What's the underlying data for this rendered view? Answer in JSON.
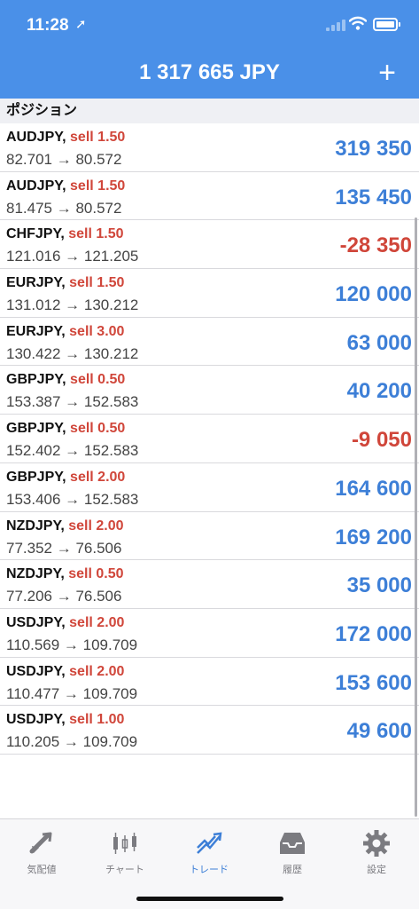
{
  "status_bar": {
    "time": "11:28",
    "location_arrow": "➚"
  },
  "nav": {
    "title": "1 317 665 JPY",
    "add_label": "+"
  },
  "section_header": "ポジション",
  "positions": [
    {
      "pair": "AUDJPY,",
      "side": "sell 1.50",
      "prices": "82.701 → 80.572",
      "pnl": "319 350",
      "sign": "pos"
    },
    {
      "pair": "AUDJPY,",
      "side": "sell 1.50",
      "prices": "81.475 → 80.572",
      "pnl": "135 450",
      "sign": "pos"
    },
    {
      "pair": "CHFJPY,",
      "side": "sell 1.50",
      "prices": "121.016 → 121.205",
      "pnl": "-28 350",
      "sign": "neg"
    },
    {
      "pair": "EURJPY,",
      "side": "sell 1.50",
      "prices": "131.012 → 130.212",
      "pnl": "120 000",
      "sign": "pos"
    },
    {
      "pair": "EURJPY,",
      "side": "sell 3.00",
      "prices": "130.422 → 130.212",
      "pnl": "63 000",
      "sign": "pos"
    },
    {
      "pair": "GBPJPY,",
      "side": "sell 0.50",
      "prices": "153.387 → 152.583",
      "pnl": "40 200",
      "sign": "pos"
    },
    {
      "pair": "GBPJPY,",
      "side": "sell 0.50",
      "prices": "152.402 → 152.583",
      "pnl": "-9 050",
      "sign": "neg"
    },
    {
      "pair": "GBPJPY,",
      "side": "sell 2.00",
      "prices": "153.406 → 152.583",
      "pnl": "164 600",
      "sign": "pos"
    },
    {
      "pair": "NZDJPY,",
      "side": "sell 2.00",
      "prices": "77.352 → 76.506",
      "pnl": "169 200",
      "sign": "pos"
    },
    {
      "pair": "NZDJPY,",
      "side": "sell 0.50",
      "prices": "77.206 → 76.506",
      "pnl": "35 000",
      "sign": "pos"
    },
    {
      "pair": "USDJPY,",
      "side": "sell 2.00",
      "prices": "110.569 → 109.709",
      "pnl": "172 000",
      "sign": "pos"
    },
    {
      "pair": "USDJPY,",
      "side": "sell 2.00",
      "prices": "110.477 → 109.709",
      "pnl": "153 600",
      "sign": "pos"
    },
    {
      "pair": "USDJPY,",
      "side": "sell 1.00",
      "prices": "110.205 → 109.709",
      "pnl": "49 600",
      "sign": "pos"
    }
  ],
  "tabs": [
    {
      "label": "気配値",
      "icon": "quotes-icon",
      "active": false
    },
    {
      "label": "チャート",
      "icon": "chart-icon",
      "active": false
    },
    {
      "label": "トレード",
      "icon": "trade-icon",
      "active": true
    },
    {
      "label": "履歴",
      "icon": "history-icon",
      "active": false
    },
    {
      "label": "設定",
      "icon": "settings-icon",
      "active": false
    }
  ],
  "colors": {
    "brand_blue": "#4a90e8",
    "profit_blue": "#3d7fd7",
    "loss_red": "#d0463a",
    "tab_inactive": "#7b7b80"
  }
}
